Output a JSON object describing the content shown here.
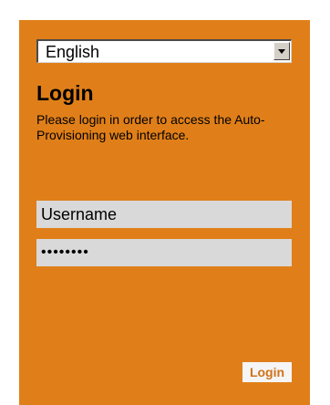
{
  "language_select": {
    "value": "English"
  },
  "title": "Login",
  "description": "Please login in order to access the Auto-Provisioning web interface.",
  "username_field": {
    "value": "Username"
  },
  "password_field": {
    "masked_value": "••••••••"
  },
  "login_button_label": "Login",
  "colors": {
    "panel": "#e07f19",
    "field": "#d9d9d9",
    "button_text": "#d07218"
  }
}
